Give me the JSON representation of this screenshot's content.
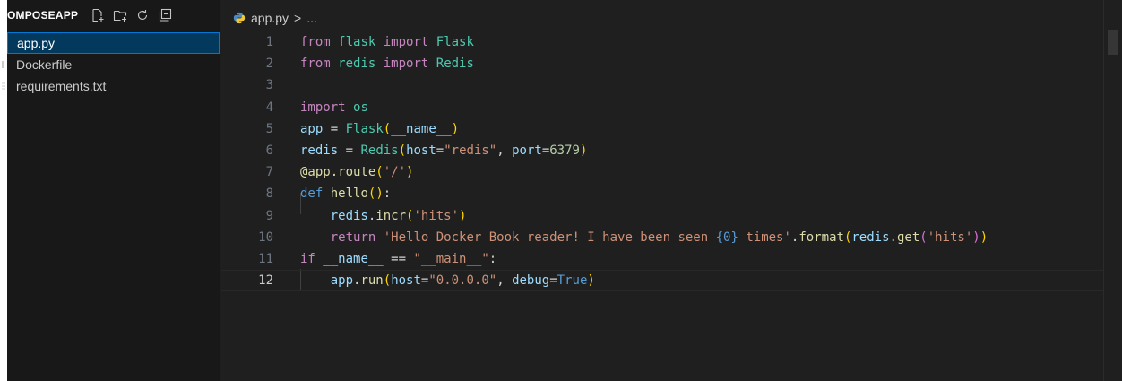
{
  "explorer": {
    "title": "OMPOSEAPP",
    "icons": [
      "new-file-icon",
      "new-folder-icon",
      "refresh-icon",
      "collapse-all-icon"
    ],
    "files": [
      {
        "name": "app.py",
        "active": true
      },
      {
        "name": "Dockerfile",
        "active": false
      },
      {
        "name": "requirements.txt",
        "active": false
      }
    ]
  },
  "breadcrumb": {
    "file": "app.py",
    "separator": ">",
    "more": "..."
  },
  "editor": {
    "current_line": 12,
    "lines": [
      {
        "n": "1"
      },
      {
        "n": "2"
      },
      {
        "n": "3"
      },
      {
        "n": "4"
      },
      {
        "n": "5"
      },
      {
        "n": "6"
      },
      {
        "n": "7"
      },
      {
        "n": "8"
      },
      {
        "n": "9"
      },
      {
        "n": "10"
      },
      {
        "n": "11"
      },
      {
        "n": "12"
      }
    ],
    "tokens": {
      "l1_from": "from",
      "l1_mod": "flask",
      "l1_import": "import",
      "l1_cls": "Flask",
      "l2_from": "from",
      "l2_mod": "redis",
      "l2_import": "import",
      "l2_cls": "Redis",
      "l4_import": "import",
      "l4_mod": "os",
      "l5_var": "app",
      "l5_eq": "=",
      "l5_cls": "Flask",
      "l5_p1": "(",
      "l5_name": "__name__",
      "l5_p2": ")",
      "l6_var": "redis",
      "l6_eq": "=",
      "l6_cls": "Redis",
      "l6_p1": "(",
      "l6_host": "host",
      "l6_eq2": "=",
      "l6_str": "\"redis\"",
      "l6_comma": ", ",
      "l6_port": "port",
      "l6_eq3": "=",
      "l6_num": "6379",
      "l6_p2": ")",
      "l7_at": "@app.route",
      "l7_p1": "(",
      "l7_str": "'/'",
      "l7_p2": ")",
      "l8_def": "def",
      "l8_fn": "hello",
      "l8_p": "()",
      "l8_colon": ":",
      "l9_var": "redis",
      "l9_dot": ".",
      "l9_fn": "incr",
      "l9_p1": "(",
      "l9_str": "'hits'",
      "l9_p2": ")",
      "l10_ret": "return",
      "l10_str1": "'Hello Docker Book reader! I have been seen ",
      "l10_fmt": "{0}",
      "l10_str2": " times'",
      "l10_dot": ".",
      "l10_fn": "format",
      "l10_p1": "(",
      "l10_var": "redis",
      "l10_dot2": ".",
      "l10_fn2": "get",
      "l10_p2": "(",
      "l10_str3": "'hits'",
      "l10_p3": ")",
      "l10_p4": ")",
      "l11_if": "if",
      "l11_name": "__name__",
      "l11_eq": "==",
      "l11_str": "\"__main__\"",
      "l11_colon": ":",
      "l12_var": "app",
      "l12_dot": ".",
      "l12_fn": "run",
      "l12_p1": "(",
      "l12_host": "host",
      "l12_eq": "=",
      "l12_str": "\"0.0.0.0\"",
      "l12_comma": ", ",
      "l12_debug": "debug",
      "l12_eq2": "=",
      "l12_true": "True",
      "l12_p2": ")"
    }
  }
}
